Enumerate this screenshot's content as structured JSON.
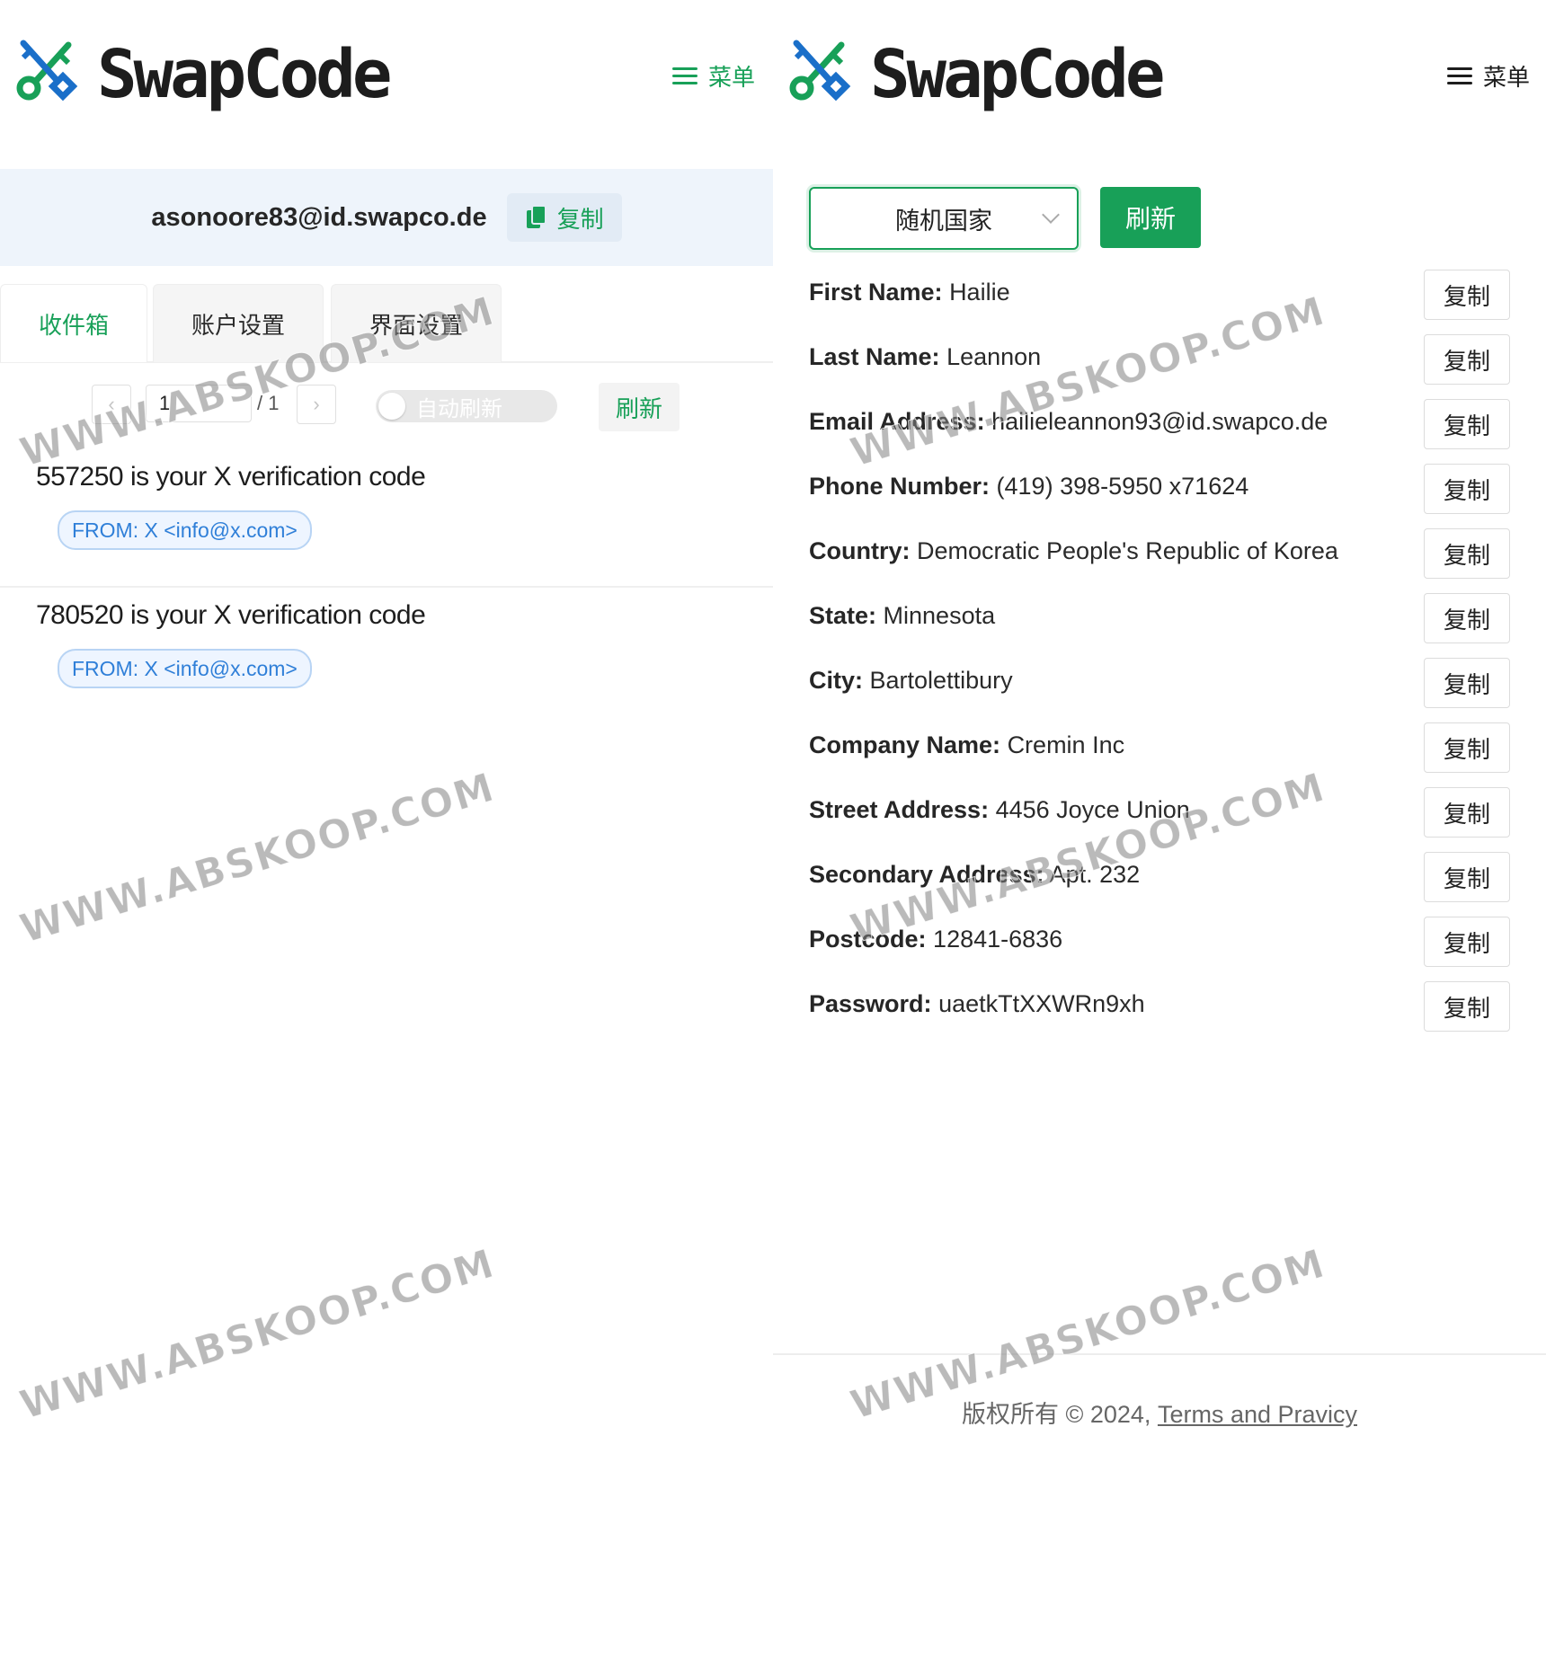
{
  "left": {
    "brand": "SwapCode",
    "menu_label": "菜单",
    "email": "asonoore83@id.swapco.de",
    "copy_label": "复制",
    "tabs": [
      {
        "label": "收件箱",
        "active": true
      },
      {
        "label": "账户设置",
        "active": false
      },
      {
        "label": "界面设置",
        "active": false
      }
    ],
    "pagination": {
      "current": "1",
      "total": "/ 1"
    },
    "auto_refresh_label": "自动刷新",
    "refresh_label": "刷新",
    "mails": [
      {
        "subject": "557250 is your X verification code",
        "from": "FROM: X <info@x.com>"
      },
      {
        "subject": "780520 is your X verification code",
        "from": "FROM: X <info@x.com>"
      }
    ]
  },
  "right": {
    "brand": "SwapCode",
    "menu_label": "菜单",
    "country_select": "随机国家",
    "refresh_label": "刷新",
    "copy_label": "复制",
    "fields": [
      {
        "label": "First Name:",
        "value": "Hailie"
      },
      {
        "label": "Last Name:",
        "value": "Leannon"
      },
      {
        "label": "Email Address:",
        "value": "hailieleannon93@id.swapco.de"
      },
      {
        "label": "Phone Number:",
        "value": "(419) 398-5950 x71624"
      },
      {
        "label": "Country:",
        "value": "Democratic People's Republic of Korea"
      },
      {
        "label": "State:",
        "value": "Minnesota"
      },
      {
        "label": "City:",
        "value": "Bartolettibury"
      },
      {
        "label": "Company Name:",
        "value": "Cremin Inc"
      },
      {
        "label": "Street Address:",
        "value": "4456 Joyce Union"
      },
      {
        "label": "Secondary Address:",
        "value": "Apt. 232"
      },
      {
        "label": "Postcode:",
        "value": "12841-6836"
      },
      {
        "label": "Password:",
        "value": "uaetkTtXXWRn9xh"
      }
    ],
    "footer": {
      "copyright": "版权所有 © 2024, ",
      "link": "Terms and Pravicy"
    }
  },
  "watermark": "WWW.ABSKOOP.COM",
  "colors": {
    "accent": "#18a058",
    "tag_blue": "#2f7fd8",
    "email_bar_bg": "#eef4fb"
  }
}
